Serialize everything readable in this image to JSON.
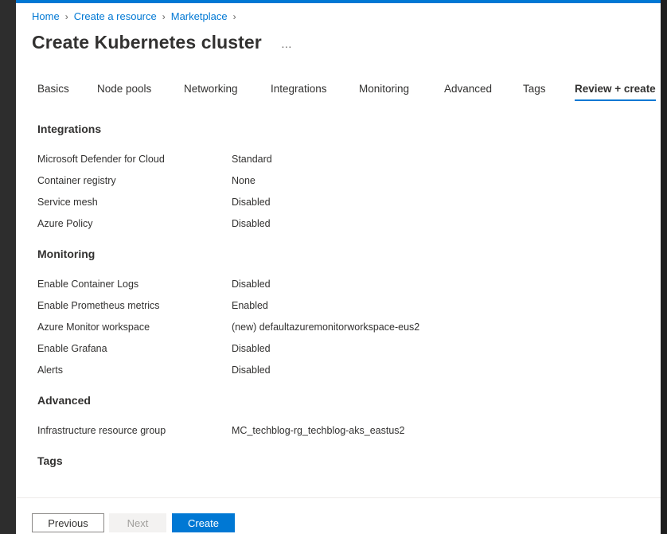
{
  "breadcrumb": {
    "items": [
      "Home",
      "Create a resource",
      "Marketplace"
    ],
    "separator": "›"
  },
  "page": {
    "title": "Create Kubernetes cluster",
    "more_icon": "…"
  },
  "tabs": [
    {
      "label": "Basics",
      "active": false
    },
    {
      "label": "Node pools",
      "active": false
    },
    {
      "label": "Networking",
      "active": false
    },
    {
      "label": "Integrations",
      "active": false
    },
    {
      "label": "Monitoring",
      "active": false
    },
    {
      "label": "Advanced",
      "active": false
    },
    {
      "label": "Tags",
      "active": false
    },
    {
      "label": "Review + create",
      "active": true
    }
  ],
  "sections": {
    "integrations": {
      "title": "Integrations",
      "rows": [
        {
          "label": "Microsoft Defender for Cloud",
          "value": "Standard"
        },
        {
          "label": "Container registry",
          "value": "None"
        },
        {
          "label": "Service mesh",
          "value": "Disabled"
        },
        {
          "label": "Azure Policy",
          "value": "Disabled"
        }
      ]
    },
    "monitoring": {
      "title": "Monitoring",
      "rows": [
        {
          "label": "Enable Container Logs",
          "value": "Disabled"
        },
        {
          "label": "Enable Prometheus metrics",
          "value": "Enabled"
        },
        {
          "label": "Azure Monitor workspace",
          "value": "(new) defaultazuremonitorworkspace-eus2"
        },
        {
          "label": "Enable Grafana",
          "value": "Disabled"
        },
        {
          "label": "Alerts",
          "value": "Disabled"
        }
      ]
    },
    "advanced": {
      "title": "Advanced",
      "rows": [
        {
          "label": "Infrastructure resource group",
          "value": "MC_techblog-rg_techblog-aks_eastus2"
        }
      ]
    },
    "tags": {
      "title": "Tags"
    }
  },
  "footer": {
    "previous_label": "Previous",
    "next_label": "Next",
    "create_label": "Create"
  },
  "colors": {
    "accent": "#0078d4",
    "text": "#323130",
    "disabled_text": "#a19f9d"
  }
}
